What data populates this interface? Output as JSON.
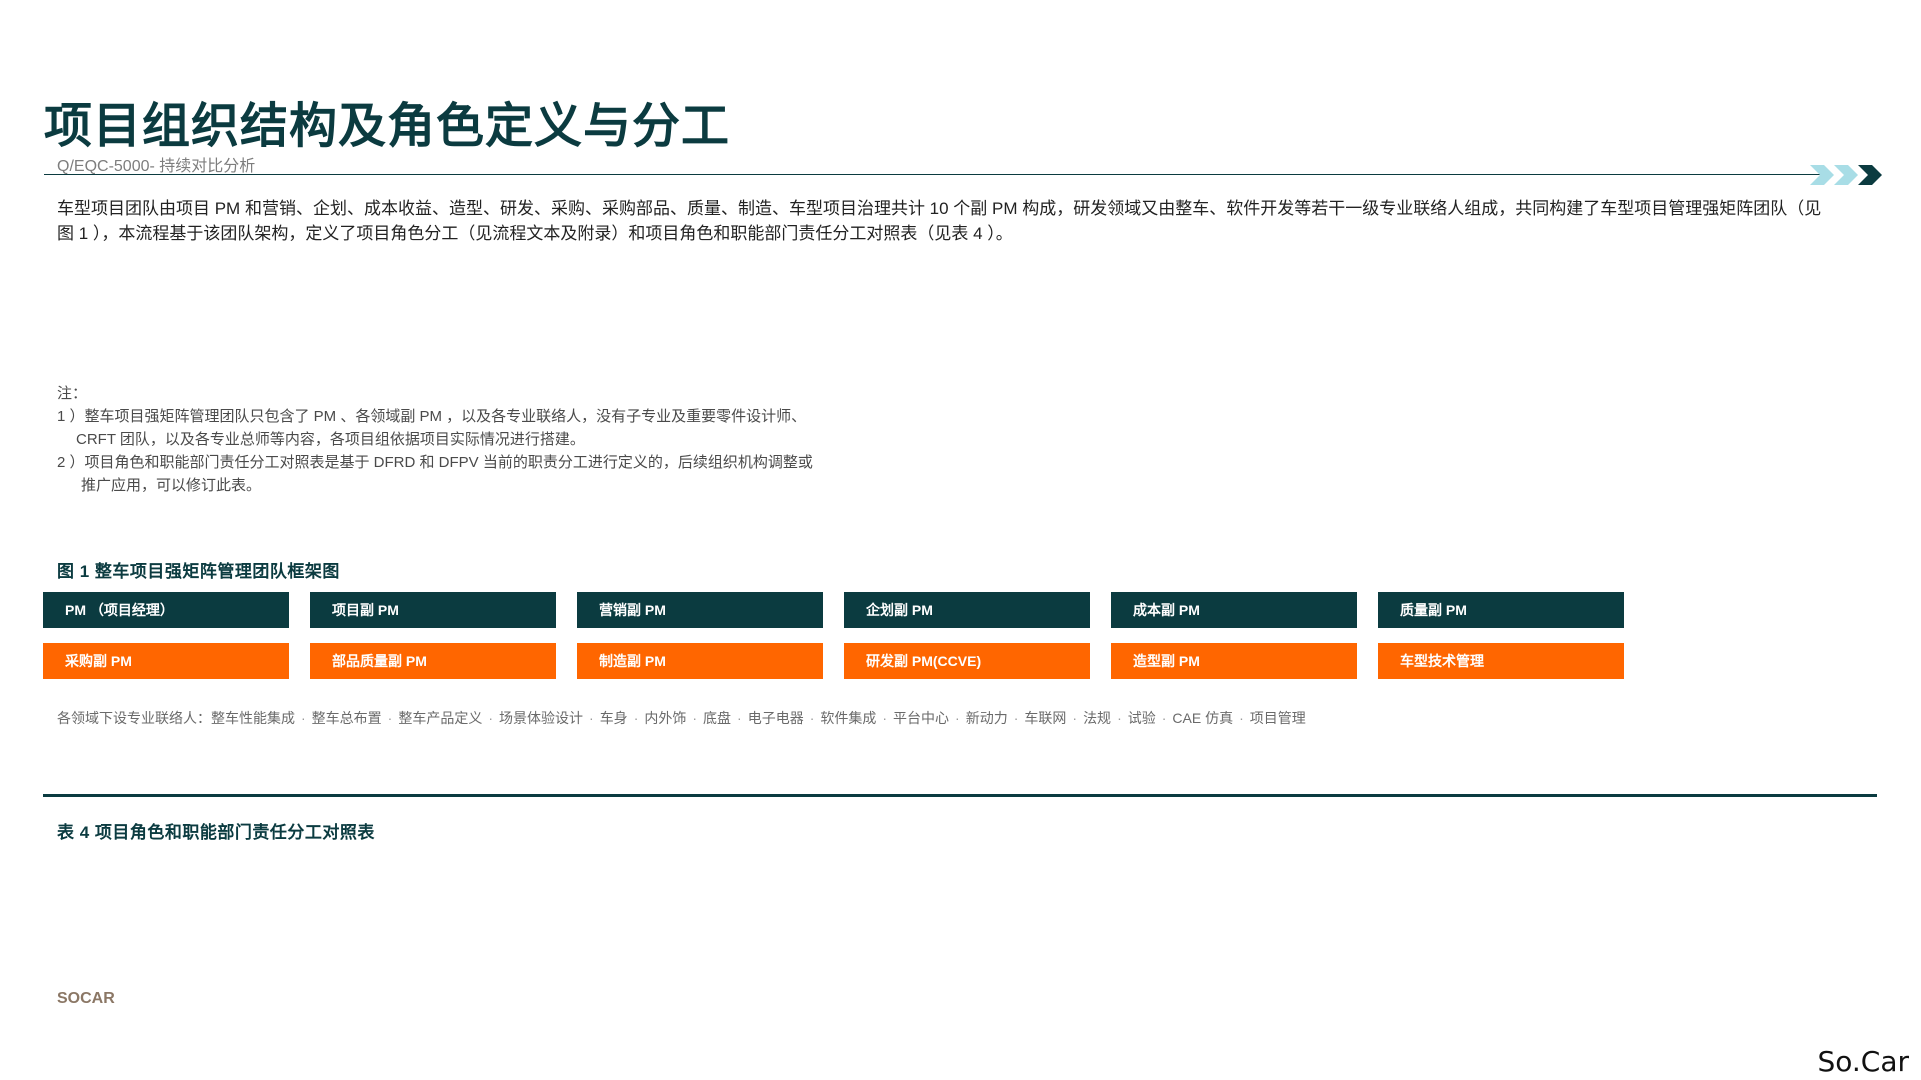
{
  "header": {
    "title": "项目组织结构及角色定义与分工",
    "doc_number": "Q/EQC-5000- 持续对比分析"
  },
  "intro": "车型项目团队由项目 PM 和营销、企划、成本收益、造型、研发、采购、采购部品、质量、制造、车型项目治理共计 10 个副 PM 构成，研发领域又由整车、软件开发等若干一级专业联络人组成，共同构建了车型项目管理强矩阵团队（见图 1 ），本流程基于该团队架构，定义了项目角色分工（见流程文本及附录）和项目角色和职能部门责任分工对照表（见表 4 ）。",
  "notes": {
    "heading": "注：",
    "note1_line1": "1 ）整车项目强矩阵管理团队只包含了 PM 、各领域副 PM ，以及各专业联络人，没有子专业及重要零件设计师、",
    "note1_line2": "CRFT 团队，以及各专业总师等内容，各项目组依据项目实际情况进行搭建。",
    "note2_line1": "2 ）项目角色和职能部门责任分工对照表是基于 DFRD 和 DFPV 当前的职责分工进行定义的，后续组织机构调整或",
    "note2_line2": "推广应用，可以修订此表。"
  },
  "figure": {
    "title": "图 1   整车项目强矩阵管理团队框架图",
    "row1": [
      "PM （项目经理）",
      "项目副 PM",
      "营销副 PM",
      "企划副 PM",
      "成本副 PM",
      "质量副 PM"
    ],
    "row2": [
      "采购副 PM",
      "部品质量副 PM",
      "制造副 PM",
      "研发副 PM(CCVE)",
      "造型副 PM",
      "车型技术管理"
    ],
    "contacts_prefix": "各领域下设专业联络人：",
    "contacts": [
      "整车性能集成",
      "整车总布置",
      "整车产品定义",
      "场景体验设计",
      "车身",
      "内外饰",
      "底盘",
      "电子电器",
      "软件集成",
      "平台中心",
      "新动力",
      "车联网",
      "法规",
      "试验",
      "CAE 仿真",
      "项目管理"
    ]
  },
  "table": {
    "title": "表 4   项目角色和职能部门责任分工对照表"
  },
  "footer": {
    "label": "SOCAR",
    "logo_text": "So.Car"
  },
  "colors": {
    "primary_dark": "#0b3b40",
    "accent_orange": "#ff6600",
    "chevron_light": "#a8dde6"
  },
  "icons": {
    "header_decoration": "triple-chevron-right-icon"
  }
}
